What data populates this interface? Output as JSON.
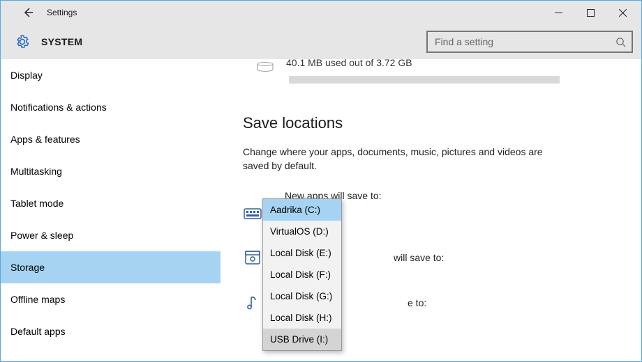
{
  "window": {
    "title": "Settings",
    "category": "SYSTEM"
  },
  "search": {
    "placeholder": "Find a setting"
  },
  "sidebar": {
    "items": [
      "Display",
      "Notifications & actions",
      "Apps & features",
      "Multitasking",
      "Tablet mode",
      "Power & sleep",
      "Storage",
      "Offline maps",
      "Default apps"
    ],
    "active_index": 6
  },
  "content": {
    "usage_text_cut": "40.1 MB used out of 3.72 GB",
    "section_title": "Save locations",
    "section_desc": "Change where your apps, documents, music, pictures and videos are saved by default.",
    "rows": [
      {
        "label": "New apps will save to:",
        "icon": "apps"
      },
      {
        "label_fragment": "will save to:",
        "icon": "docs"
      },
      {
        "label_fragment": "e to:",
        "icon": "music"
      }
    ]
  },
  "dropdown": {
    "options": [
      "Aadrika (C:)",
      "VirtualOS (D:)",
      "Local Disk (E:)",
      "Local Disk (F:)",
      "Local Disk (G:)",
      "Local Disk (H:)",
      "USB Drive (I:)"
    ],
    "selected_index": 0,
    "hover_index": 6
  }
}
